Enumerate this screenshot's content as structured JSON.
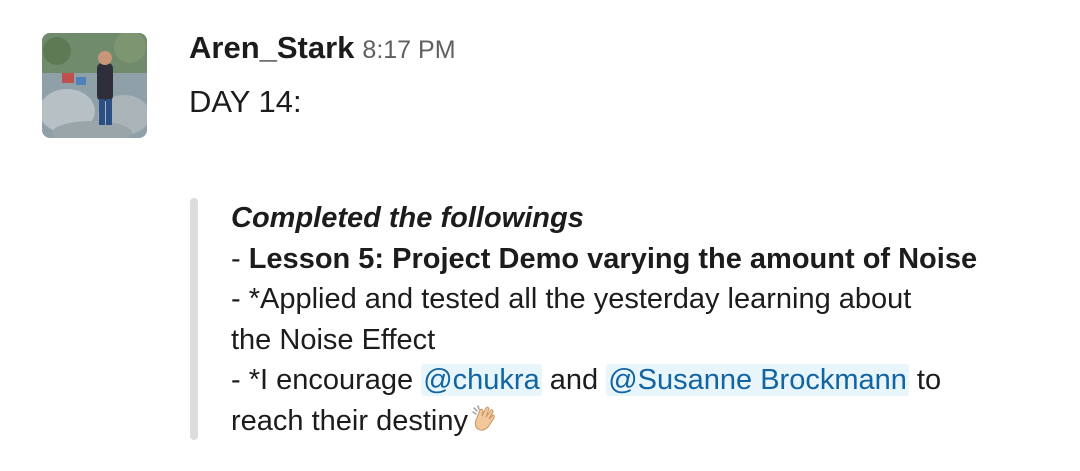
{
  "message": {
    "author": "Aren_Stark",
    "timestamp": "8:17 PM",
    "first_line": "DAY 14:",
    "quote": {
      "heading": "Completed the followings",
      "line1_prefix": "- ",
      "line1_bold": "Lesson 5: Project Demo varying the amount of Noise",
      "line2": "- *Applied and tested all the yesterday learning about",
      "line3": "the Noise Effect",
      "line4_prefix": "- *I encourage ",
      "mention1": "@chukra",
      "line4_mid": " and ",
      "mention2": "@Susanne Brockmann",
      "line4_suffix": " to",
      "line5": "reach their destiny",
      "emoji": "clapping-hands-icon"
    }
  },
  "colors": {
    "text": "#1d1c1d",
    "timestamp": "#616061",
    "mention_text": "#1264a3",
    "mention_bg": "#e8f5fa",
    "quote_bar": "#dddddd"
  }
}
